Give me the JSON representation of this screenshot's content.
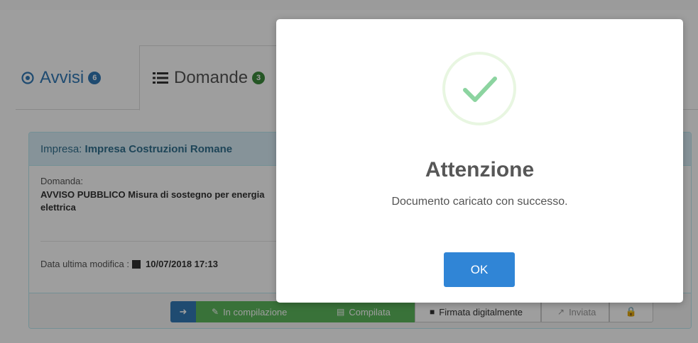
{
  "tabs": [
    {
      "label": "Avvisi",
      "count": "6"
    },
    {
      "label": "Domande",
      "count": "3"
    }
  ],
  "panel": {
    "impresa_prefix": "Impresa:",
    "impresa_name": "Impresa Costruzioni Romane",
    "domanda_label": "Domanda:",
    "domanda_title": "AVVISO PUBBLICO Misura di sostegno per energia elettrica",
    "data_label": "Data ultima modifica :",
    "data_value": "10/07/2018 17:13"
  },
  "steps": {
    "in_compilazione": "In compilazione",
    "compilata": "Compilata",
    "firmata": "Firmata digitalmente",
    "inviata": "Inviata"
  },
  "modal": {
    "title": "Attenzione",
    "message": "Documento caricato con successo.",
    "ok_label": "OK"
  },
  "colors": {
    "primary": "#337ab7",
    "success": "#5cb85c",
    "confirm_button": "#3085d6",
    "checkmark": "#8CD4A0"
  }
}
